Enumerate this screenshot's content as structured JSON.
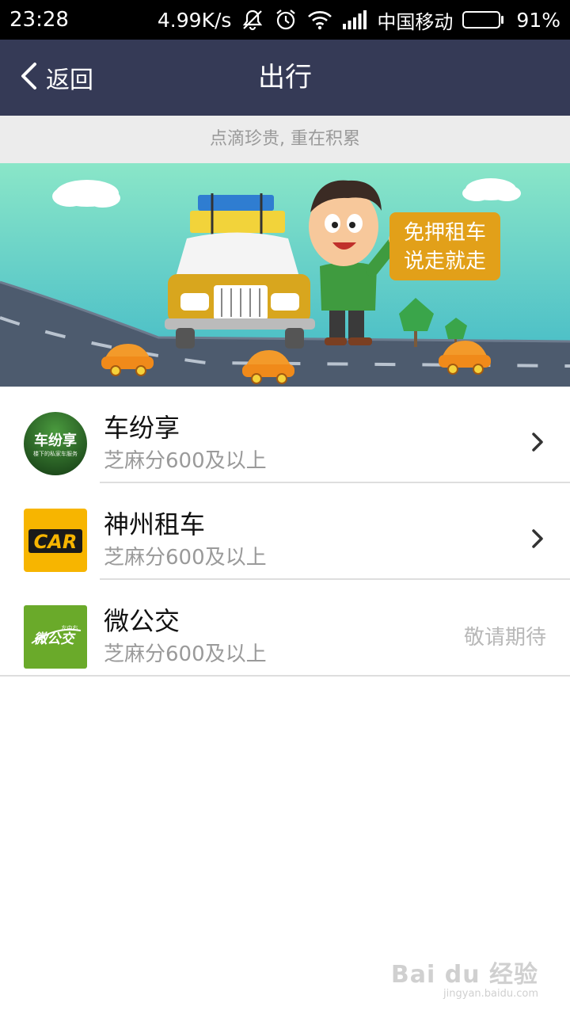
{
  "status_bar": {
    "time": "23:28",
    "net_speed": "4.99K/s",
    "carrier": "中国移动",
    "battery_pct": "91%",
    "battery_level": 0.91,
    "icons": [
      "mute-icon",
      "alarm-icon",
      "wifi-icon",
      "signal-icon",
      "battery-icon"
    ]
  },
  "nav": {
    "back_label": "返回",
    "title": "出行"
  },
  "tip": "点滴珍贵, 重在积累",
  "banner": {
    "sign_line1": "免押租车",
    "sign_line2": "说走就走"
  },
  "services": [
    {
      "name": "车纷享",
      "requirement": "芝麻分600及以上",
      "logo_text": "车纷享",
      "logo_tagline": "楼下的私家车服务",
      "logo_color": "#2e6b2a",
      "action": "chevron-right-icon"
    },
    {
      "name": "神州租车",
      "requirement": "芝麻分600及以上",
      "logo_text": "CAR",
      "logo_color": "#f7b500",
      "action": "chevron-right-icon"
    },
    {
      "name": "微公交",
      "requirement": "芝麻分600及以上",
      "logo_text": "微公交",
      "logo_tagline": "左中右",
      "logo_color": "#6aaa2a",
      "status": "敬请期待"
    }
  ],
  "watermark": {
    "brand": "Bai du 经验",
    "url": "jingyan.baidu.com"
  },
  "colors": {
    "nav_bg": "#353a56",
    "tip_bg": "#ececec",
    "battery": "#56e31f"
  }
}
